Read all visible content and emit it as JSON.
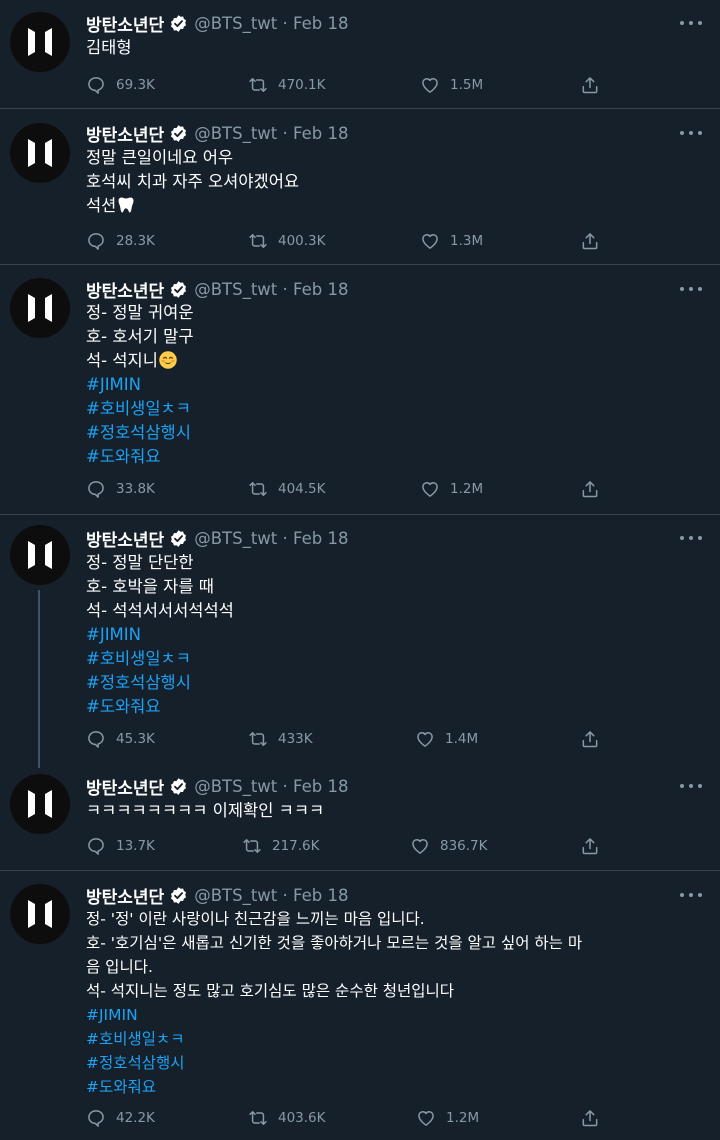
{
  "account": {
    "name": "방탄소년단",
    "handle_date": "@BTS_twt · Feb 18",
    "avatar_text": "BTS"
  },
  "colors": {
    "background": "#15202b",
    "border": "#38444d",
    "muted": "#8899a6",
    "link": "#1da1f2",
    "verified": "#ffffff"
  },
  "tweets": [
    {
      "lines": [
        "김태형"
      ],
      "stats": {
        "replies": "69.3K",
        "retweets": "470.1K",
        "likes": "1.5M"
      }
    },
    {
      "lines": [
        "정말 큰일이네요 어우",
        "호석씨 치과 자주 오셔야겠어요",
        "석션"
      ],
      "stats": {
        "replies": "28.3K",
        "retweets": "400.3K",
        "likes": "1.3M"
      }
    },
    {
      "lines": [
        "정- 정말 귀여운",
        "호- 호서기 말구",
        "석- 석지니"
      ],
      "hashtags": [
        "#JIMIN",
        "#호비생일ㅊㅋ",
        "#정호석삼행시",
        "#도와줘요"
      ],
      "stats": {
        "replies": "33.8K",
        "retweets": "404.5K",
        "likes": "1.2M"
      }
    },
    {
      "lines": [
        "정- 정말 단단한",
        "호- 호박을 자를 때",
        "석- 석석서서서석석석"
      ],
      "hashtags": [
        "#JIMIN",
        "#호비생일ㅊㅋ",
        "#정호석삼행시",
        "#도와줘요"
      ],
      "stats": {
        "replies": "45.3K",
        "retweets": "433K",
        "likes": "1.4M"
      }
    },
    {
      "lines": [
        "ㅋㅋㅋㅋㅋㅋㅋㅋ 이제확인 ㅋㅋㅋ"
      ],
      "stats": {
        "replies": "13.7K",
        "retweets": "217.6K",
        "likes": "836.7K"
      }
    },
    {
      "lines": [
        "정- '정' 이란 사랑이나 친근감을 느끼는 마음 입니다.",
        "호- '호기심'은 새롭고 신기한 것을 좋아하거나 모르는 것을 알고 싶어 하는 마",
        "음 입니다.",
        "석- 석지니는 정도 많고 호기심도 많은 순수한 청년입니다"
      ],
      "hashtags": [
        "#JIMIN",
        "#호비생일ㅊㅋ",
        "#정호석삼행시",
        "#도와줘요"
      ],
      "stats": {
        "replies": "42.2K",
        "retweets": "403.6K",
        "likes": "1.2M"
      }
    }
  ]
}
